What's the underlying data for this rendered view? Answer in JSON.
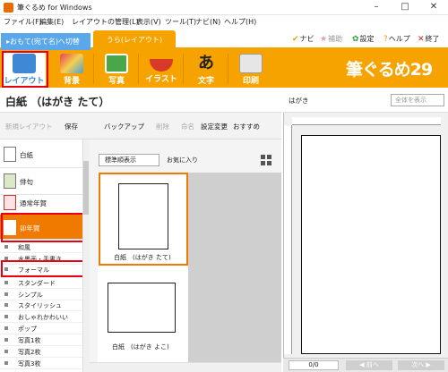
{
  "window": {
    "title": "筆ぐるめ for Windows",
    "minimize": "–",
    "maximize": "□",
    "close": "✕"
  },
  "menu": [
    "ファイル(F)",
    "編集(E)",
    "レイアウトの管理(L)",
    "表示(V)",
    "ツール(T)",
    "ナビ(N)",
    "ヘルプ(H)"
  ],
  "tabs": {
    "switch_front": "▸おもて(宛て名)へ切替",
    "current": "うら(レイアウト)"
  },
  "top_buttons": {
    "navi": "ナビ",
    "hokan": "補助",
    "settings": "設定",
    "help": "ヘルプ",
    "exit": "終了"
  },
  "toolbar": {
    "items": [
      {
        "label": "レイアウト",
        "icon": "layout-icon",
        "color": "#3f88d6"
      },
      {
        "label": "背景",
        "icon": "background-icon",
        "color": "#e4415a"
      },
      {
        "label": "写真",
        "icon": "photo-icon",
        "color": "#4aa64a"
      },
      {
        "label": "イラスト",
        "icon": "illustration-icon",
        "color": "#d83a2a"
      },
      {
        "label": "文字",
        "icon": "text-icon",
        "color": "#333333"
      },
      {
        "label": "印刷",
        "icon": "printer-icon",
        "color": "#dddddd"
      }
    ],
    "logo": "筆ぐるめ29"
  },
  "page_title": "白紙 （はがき たて）",
  "actions": {
    "new_layout": "新規レイアウト",
    "save": "保存",
    "backup": "バックアップ",
    "delete": "削除",
    "edit": "命名",
    "change_settings": "設定変更",
    "recommend": "おすすめ"
  },
  "categories": [
    {
      "label": "白紙"
    },
    {
      "label": "俳句"
    },
    {
      "label": "通常年賀"
    },
    {
      "label": "卯年賀"
    }
  ],
  "subcategories": [
    "和風",
    "水墨画・手書き",
    "フォーマル",
    "スタンダード",
    "シンプル",
    "スタイリッシュ",
    "おしゃれかわいい",
    "ポップ",
    "写真1枚",
    "写真2枚",
    "写真3枚"
  ],
  "view": {
    "sort_select": "標準順表示",
    "favorites": "お気に入り"
  },
  "thumbnails": [
    {
      "caption": "白紙　(はがき たて)"
    },
    {
      "caption": "白紙　(はがき よこ)"
    }
  ],
  "preview": {
    "label": "はがき",
    "zoom_select": "全体を表示",
    "page_counter": "0/0",
    "prev_label": "前へ",
    "next_label": "次へ"
  },
  "colors": {
    "accent": "#f6a300",
    "highlight": "#e60012",
    "tab_blue": "#5aa7ea"
  }
}
